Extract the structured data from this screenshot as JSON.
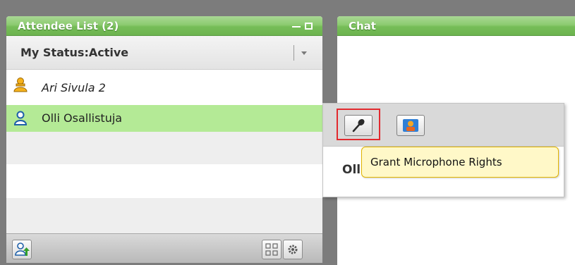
{
  "attendee_panel": {
    "title": "Attendee List (2)",
    "status_label": "My Status:Active",
    "attendees": [
      {
        "name": "Ari Sivula 2",
        "role_icon": "host-user-icon"
      },
      {
        "name": "Olli Osallistuja",
        "role_icon": "participant-user-icon"
      }
    ],
    "bottom_buttons": [
      "upload-user-icon",
      "layout-icon",
      "gear-icon"
    ]
  },
  "chat_panel": {
    "title": "Chat"
  },
  "context_popup": {
    "buttons": [
      "microphone-icon",
      "webcam-icon"
    ],
    "user_name": "Olli Osallistuja",
    "tooltip": "Grant Microphone Rights"
  },
  "colors": {
    "title_bar": "#80c464",
    "selected_row": "#b4ea96",
    "highlight_border": "#e2292e",
    "tooltip_bg": "#fff8c8"
  }
}
